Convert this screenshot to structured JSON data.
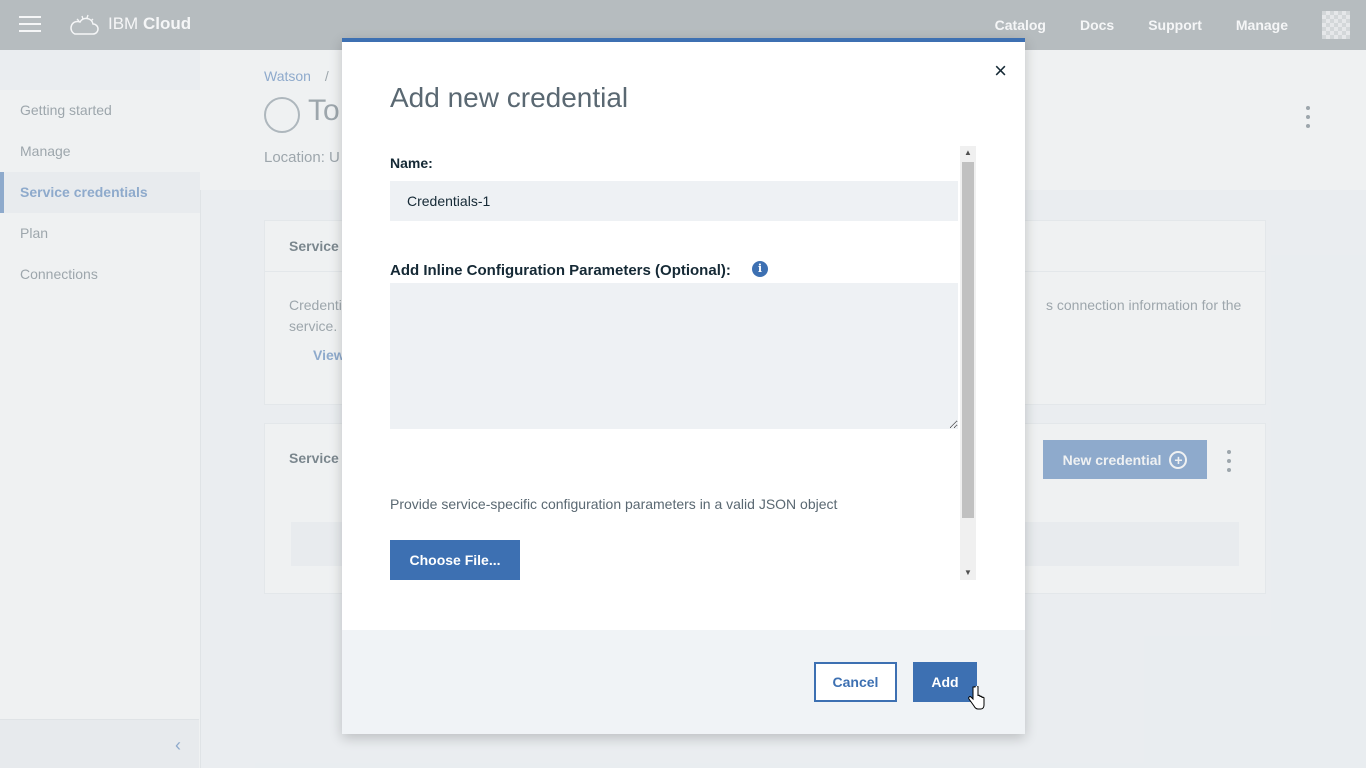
{
  "topbar": {
    "brand_prefix": "IBM",
    "brand_suffix": "Cloud",
    "nav": [
      "Catalog",
      "Docs",
      "Support",
      "Manage"
    ]
  },
  "sidebar": {
    "items": [
      {
        "label": "Getting started"
      },
      {
        "label": "Manage"
      },
      {
        "label": "Service credentials",
        "active": true
      },
      {
        "label": "Plan"
      },
      {
        "label": "Connections"
      }
    ]
  },
  "page": {
    "breadcrumb": "Watson",
    "breadcrumb_sep": "/",
    "title_partial": "To",
    "location_label": "Location: U",
    "card1": {
      "heading_partial": "Service c",
      "text_left": "Credenti",
      "text_left_line2": "service.",
      "text_right": "s connection information for the",
      "link_partial": "View"
    },
    "card2": {
      "heading_partial": "Service c",
      "new_credential_label": "New credential"
    }
  },
  "modal": {
    "title": "Add new credential",
    "close_glyph": "×",
    "name_label": "Name:",
    "name_value": "Credentials-1",
    "params_label": "Add Inline Configuration Parameters (Optional):",
    "params_value": "",
    "helper_text": "Provide service-specific configuration parameters in a valid JSON object",
    "choose_file_label": "Choose File...",
    "cancel_label": "Cancel",
    "add_label": "Add"
  },
  "colors": {
    "accent": "#3d70b2",
    "topbar": "#2d3a45"
  }
}
